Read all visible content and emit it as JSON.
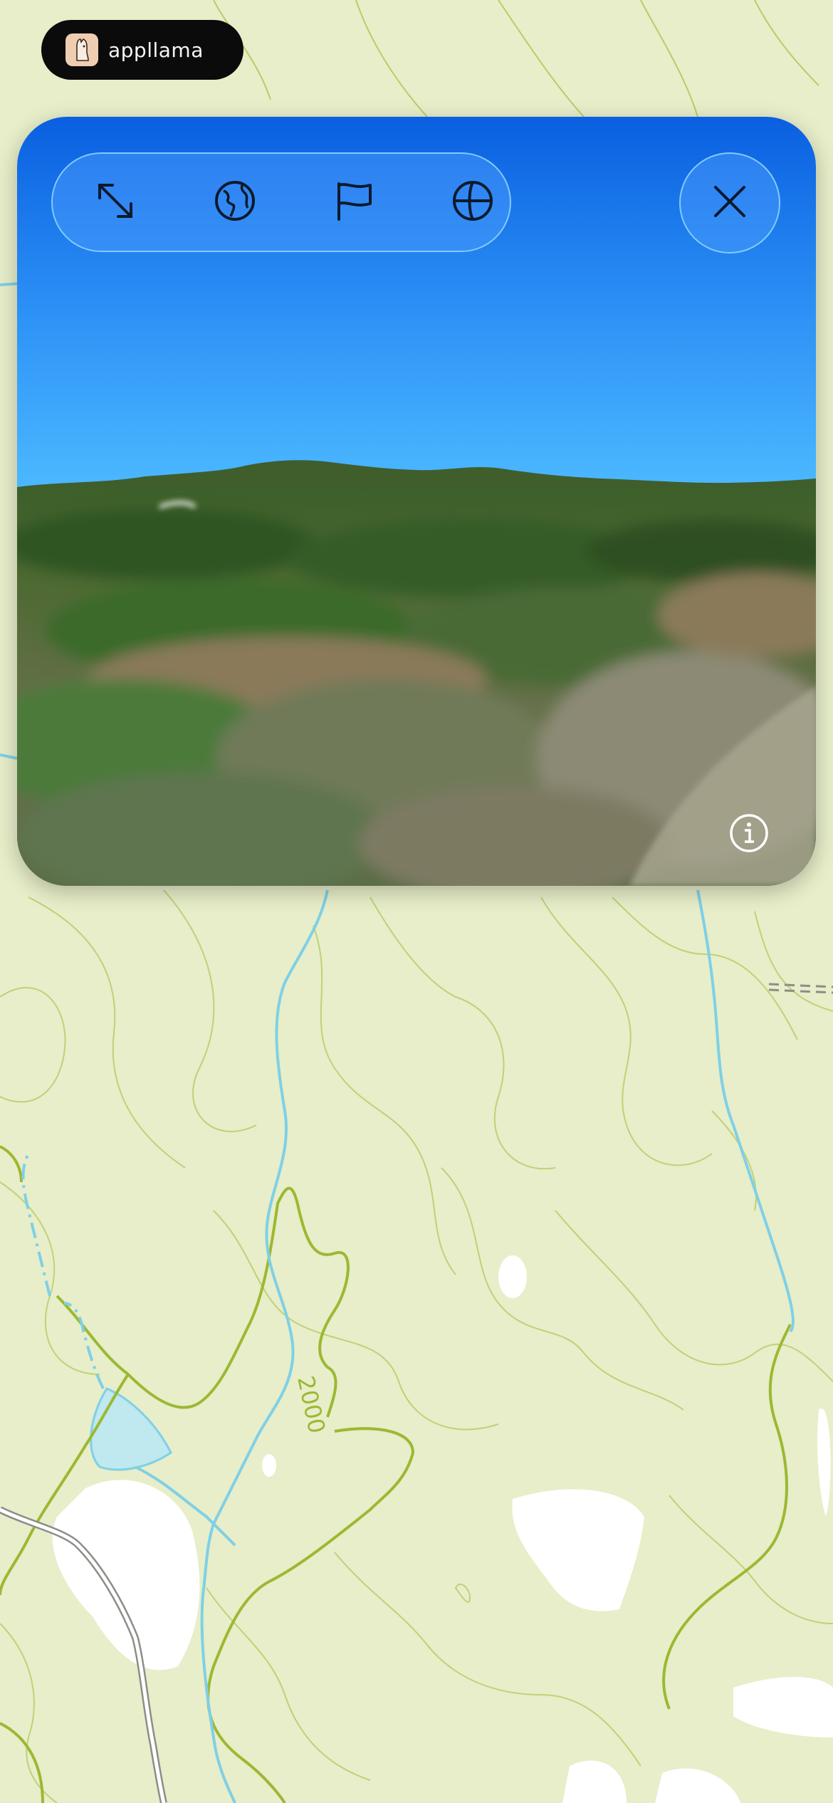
{
  "brand": {
    "name": "appllama",
    "logo_icon": "llama-icon"
  },
  "map": {
    "contour_label": "2000",
    "colors": {
      "land": "#e7eec9",
      "contour": "#9cb832",
      "water": "#7fd0e6",
      "clearing": "#ffffff",
      "road": "#8a8f88"
    }
  },
  "panel": {
    "toolbar": [
      {
        "icon": "expand-arrows-icon"
      },
      {
        "icon": "globe-icon"
      },
      {
        "icon": "flag-icon"
      },
      {
        "icon": "sphere-grid-icon"
      }
    ],
    "close_icon": "close-icon",
    "info_icon": "info-icon",
    "colors": {
      "sky_top": "#0a5fe0",
      "sky_bottom": "#48b5ff",
      "terrain": "#4a6b2f"
    }
  }
}
